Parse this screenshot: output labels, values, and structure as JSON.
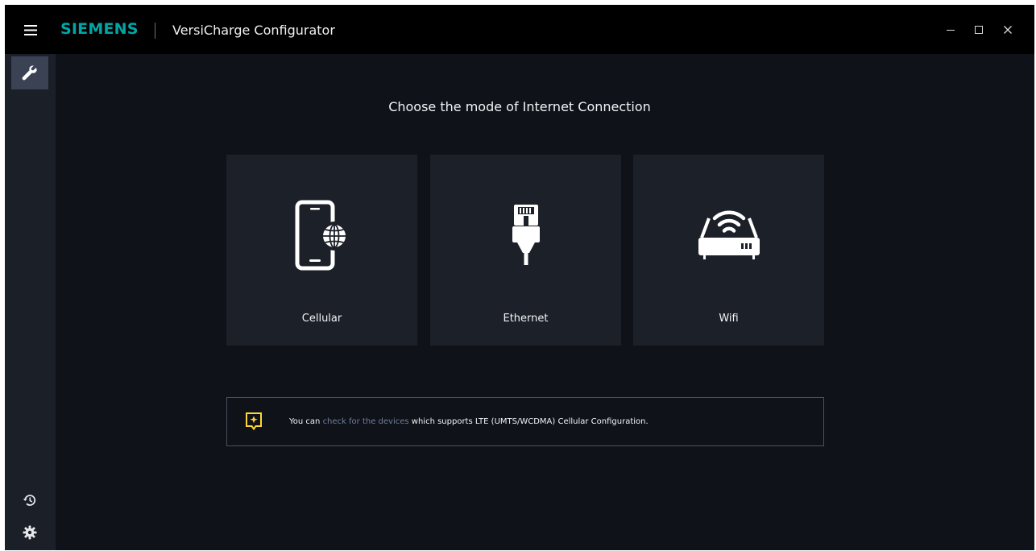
{
  "titlebar": {
    "menu_icon": "hamburger-menu-icon",
    "brand": "SIEMENS",
    "title": "VersiCharge Configurator",
    "controls": [
      "minimize-icon",
      "maximize-icon",
      "close-icon"
    ]
  },
  "sidebar": {
    "top_items": [
      {
        "icon": "wrench-icon",
        "active": true
      }
    ],
    "bottom_items": [
      {
        "icon": "history-icon"
      },
      {
        "icon": "gear-icon"
      }
    ]
  },
  "main": {
    "heading": "Choose the mode of Internet Connection",
    "cards": [
      {
        "label": "Cellular",
        "icon": "cellular-phone-globe-icon"
      },
      {
        "label": "Ethernet",
        "icon": "ethernet-plug-icon"
      },
      {
        "label": "Wifi",
        "icon": "wifi-router-icon"
      }
    ],
    "info": {
      "icon": "info-note-icon",
      "prefix": "You can ",
      "link": "check for the devices",
      "suffix": " which supports LTE (UMTS/WCDMA) Cellular Configuration."
    }
  },
  "colors": {
    "brand": "#00a6a6",
    "background": "#0f1219",
    "titlebar": "#000000",
    "sidebar": "#1a1f28",
    "card": "#1c2028",
    "accent_yellow": "#ffd732",
    "link": "#6e7f99"
  }
}
